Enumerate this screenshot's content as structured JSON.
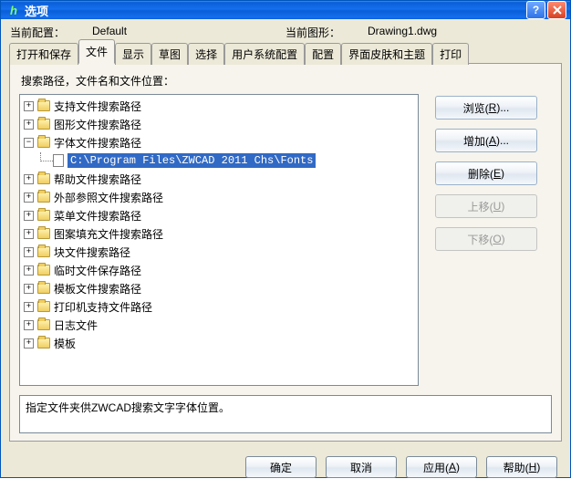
{
  "titlebar": {
    "title": "选项"
  },
  "info": {
    "current_profile_label": "当前配置：",
    "current_profile_value": "Default",
    "current_drawing_label": "当前图形：",
    "current_drawing_value": "Drawing1.dwg"
  },
  "tabs": [
    {
      "label": "打开和保存"
    },
    {
      "label": "文件"
    },
    {
      "label": "显示"
    },
    {
      "label": "草图"
    },
    {
      "label": "选择"
    },
    {
      "label": "用户系统配置"
    },
    {
      "label": "配置"
    },
    {
      "label": "界面皮肤和主题"
    },
    {
      "label": "打印"
    }
  ],
  "active_tab_index": 1,
  "section_label": "搜索路径，文件名和文件位置：",
  "tree": [
    {
      "label": "支持文件搜索路径",
      "expanded": false
    },
    {
      "label": "图形文件搜索路径",
      "expanded": false
    },
    {
      "label": "字体文件搜索路径",
      "expanded": true,
      "children": [
        {
          "label": "C:\\Program Files\\ZWCAD 2011 Chs\\Fonts",
          "selected": true,
          "type": "file"
        }
      ]
    },
    {
      "label": "帮助文件搜索路径",
      "expanded": false
    },
    {
      "label": "外部参照文件搜索路径",
      "expanded": false
    },
    {
      "label": "菜单文件搜索路径",
      "expanded": false
    },
    {
      "label": "图案填充文件搜索路径",
      "expanded": false
    },
    {
      "label": "块文件搜索路径",
      "expanded": false
    },
    {
      "label": "临时文件保存路径",
      "expanded": false
    },
    {
      "label": "模板文件搜索路径",
      "expanded": false
    },
    {
      "label": "打印机支持文件路径",
      "expanded": false
    },
    {
      "label": "日志文件",
      "expanded": false
    },
    {
      "label": "模板",
      "expanded": false
    }
  ],
  "side_buttons": {
    "browse": {
      "text": "浏览(",
      "hotkey": "R",
      "suffix": ")..."
    },
    "add": {
      "text": "增加(",
      "hotkey": "A",
      "suffix": ")..."
    },
    "remove": {
      "text": "删除(",
      "hotkey": "E",
      "suffix": ")"
    },
    "moveup": {
      "text": "上移(",
      "hotkey": "U",
      "suffix": ")"
    },
    "movedn": {
      "text": "下移(",
      "hotkey": "O",
      "suffix": ")"
    }
  },
  "status_text": "指定文件夹供ZWCAD搜索文字字体位置。",
  "footer": {
    "ok": "确定",
    "cancel": "取消",
    "apply": {
      "text": "应用(",
      "hotkey": "A",
      "suffix": ")"
    },
    "help": {
      "text": "帮助(",
      "hotkey": "H",
      "suffix": ")"
    }
  }
}
